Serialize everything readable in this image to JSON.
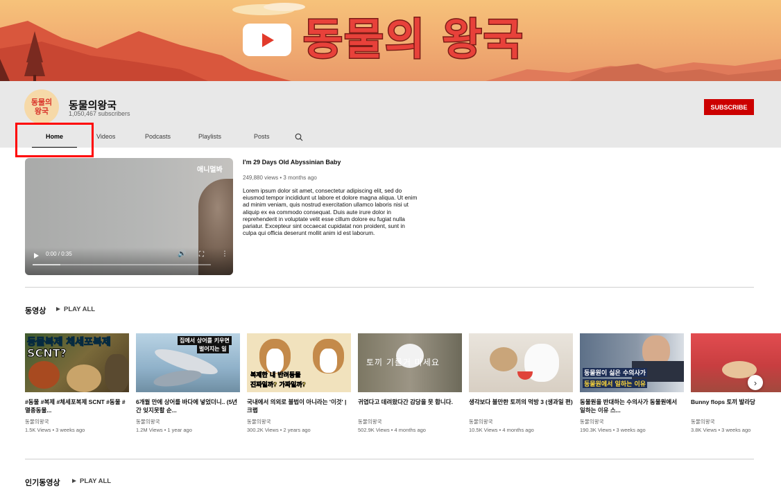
{
  "banner": {
    "title": "동물의 왕국"
  },
  "channel": {
    "avatar_text_line1": "동물의",
    "avatar_text_line2": "왕국",
    "name": "동물의왕국",
    "subscribers": "1,050,467 subscribers",
    "subscribe_label": "SUBSCRIBE"
  },
  "tabs": [
    {
      "label": "Home",
      "active": true
    },
    {
      "label": "Videos"
    },
    {
      "label": "Podcasts"
    },
    {
      "label": "Playlists"
    },
    {
      "label": "Posts"
    }
  ],
  "featured": {
    "watermark": "애니멀봐",
    "time": "0:00 / 0:35",
    "progress": 0.0,
    "title": "I'm 29 Days Old Abyssinian Baby",
    "meta": "249,880 views • 3 months ago",
    "description": "Lorem ipsum dolor sit amet, consectetur adipiscing elit, sed do eiusmod tempor incididunt ut labore et dolore magna aliqua. Ut enim ad minim veniam, quis nostrud exercitation ullamco laboris nisi ut aliquip ex ea commodo consequat. Duis aute irure dolor in reprehenderit in voluptate velit esse cillum dolore eu fugiat nulla pariatur. Excepteur sint occaecat cupidatat non proident, sunt in culpa qui officia deserunt mollit anim id est laborum."
  },
  "section1": {
    "title": "동영상",
    "play_all": "PLAY ALL"
  },
  "section2": {
    "title": "인기동영상",
    "play_all": "PLAY ALL"
  },
  "videos": [
    {
      "thumb_text_1": "동물복제 체세포복제",
      "thumb_text_2": "SCNT?",
      "title": "#동물 #복제 #체세포복제 SCNT #동물 #멸종동물...",
      "channel": "동물의왕국",
      "meta": "1.5K Views • 3 weeks ago"
    },
    {
      "thumb_text_1": "집에서 상어를 키우면",
      "thumb_text_2": "벌어지는 일",
      "title": "6개월 만에 상어를 바다에 넣었더니.. (5년간 잊지못할 순...",
      "channel": "동물의왕국",
      "meta": "1.2M Views • 1 year ago"
    },
    {
      "thumb_text_1": "복제한 내 반려동물",
      "thumb_text_2": "진짜일까? 가짜일까?",
      "title": "국내에서 의외로 불법이 아니라는 '이것' | 크랩",
      "channel": "동물의왕국",
      "meta": "300.2K Views • 2 years ago"
    },
    {
      "thumb_text_1": "토끼 기를거 마세요",
      "thumb_text_2": "",
      "title": "귀엽다고 데려왔다간 감당을 못 합니다.",
      "channel": "동물의왕국",
      "meta": "502.9K Views • 4 months ago"
    },
    {
      "thumb_text_1": "",
      "thumb_text_2": "",
      "title": "생각보다 불만한 토끼의 먹방 3 (생과일 편)",
      "channel": "동물의왕국",
      "meta": "10.5K Views • 4 months ago"
    },
    {
      "thumb_text_1": "동물원이 싫은 수의사가",
      "thumb_text_2": "동물원에서 일하는 이유",
      "title": "동물원을 반대하는 수의사가 동물원에서 일하는 이유 스...",
      "channel": "동물의왕국",
      "meta": "190.3K Views • 3 weeks ago"
    },
    {
      "thumb_text_1": "",
      "thumb_text_2": "",
      "title": "Bunny flops 토끼 발라당",
      "channel": "동물의왕국",
      "meta": "3.8K Views • 3 weeks ago"
    }
  ],
  "colors": {
    "subscribe": "#cc0000",
    "highlight": "#ff0000",
    "banner_title": "#e8413a"
  }
}
